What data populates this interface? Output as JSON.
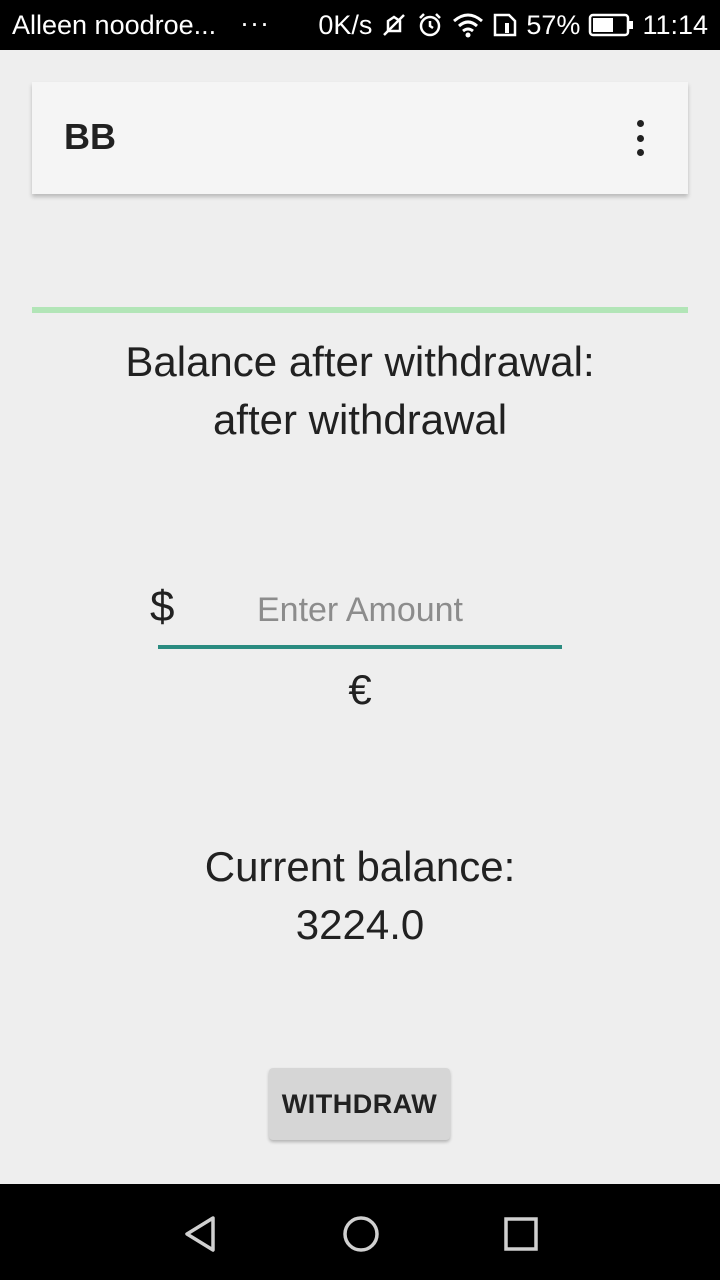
{
  "status_bar": {
    "carrier": "Alleen noodroe...",
    "dots": "···",
    "speed": "0K/s",
    "battery": "57%",
    "time": "11:14",
    "icons": [
      "mute-icon",
      "alarm-icon",
      "wifi-icon",
      "sim-icon",
      "battery-icon"
    ]
  },
  "app_bar": {
    "title": "BB",
    "menu_icon": "overflow-menu-icon"
  },
  "withdrawal": {
    "after_label_line1": "Balance after withdrawal:",
    "after_label_line2": "after withdrawal",
    "currency_symbol": "$",
    "amount_placeholder": "Enter Amount",
    "amount_value": "",
    "secondary_currency": "€"
  },
  "balance": {
    "label": "Current balance:",
    "value": "3224.0"
  },
  "actions": {
    "withdraw_label": "WITHDRAW"
  },
  "nav_bar": {
    "icons": [
      "back-icon",
      "home-icon",
      "recents-icon"
    ]
  },
  "colors": {
    "accent_line": "#b2e5b7",
    "input_underline": "#2a8b80",
    "background": "#eeeeee"
  }
}
